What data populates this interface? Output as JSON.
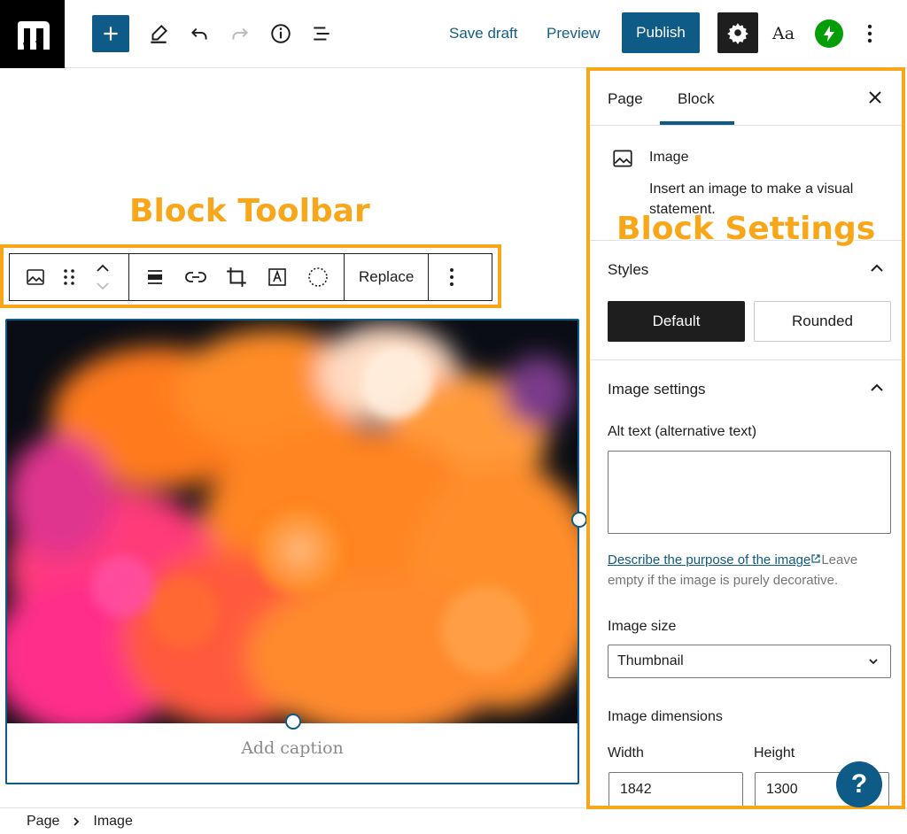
{
  "topbar": {
    "save_draft": "Save draft",
    "preview": "Preview",
    "publish": "Publish",
    "typography": "Aa"
  },
  "annotations": {
    "block_toolbar": "Block Toolbar",
    "block_settings": "Block Settings"
  },
  "block_toolbar": {
    "replace_label": "Replace"
  },
  "image_block": {
    "caption_placeholder": "Add caption"
  },
  "breadcrumb": {
    "items": [
      "Page",
      "Image"
    ]
  },
  "sidebar": {
    "tabs": [
      {
        "label": "Page",
        "active": false
      },
      {
        "label": "Block",
        "active": true
      }
    ],
    "block_card": {
      "title": "Image",
      "description": "Insert an image to make a visual statement."
    },
    "styles": {
      "heading": "Styles",
      "options": [
        "Default",
        "Rounded"
      ],
      "selected": "Default"
    },
    "image_settings": {
      "heading": "Image settings",
      "alt_label": "Alt text (alternative text)",
      "alt_value": "",
      "help_link": "Describe the purpose of the image",
      "help_text": "Leave empty if the image is purely decorative.",
      "size_label": "Image size",
      "size_value": "Thumbnail",
      "dimensions_label": "Image dimensions",
      "width_label": "Width",
      "width_value": "1842",
      "height_label": "Height",
      "height_value": "1300"
    }
  },
  "help_button": "?",
  "colors": {
    "accent": "#0d5b86",
    "annotation": "#f8a71a",
    "jetpack": "#069e08"
  }
}
